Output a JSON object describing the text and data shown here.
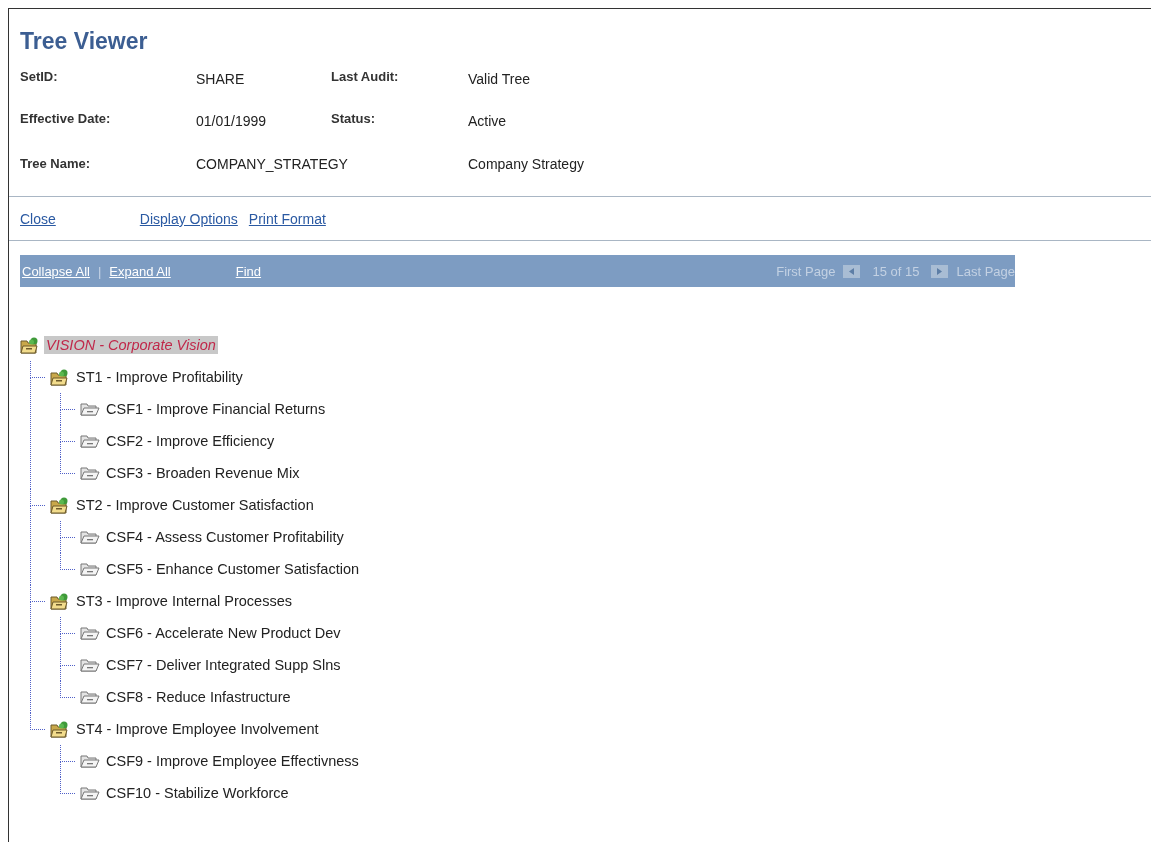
{
  "title": "Tree Viewer",
  "fields": [
    {
      "label": "SetID:",
      "value": "SHARE",
      "label2": "Last Audit:",
      "value2": "Valid Tree"
    },
    {
      "label": "Effective Date:",
      "value": "01/01/1999",
      "label2": "Status:",
      "value2": "Active"
    },
    {
      "label": "Tree Name:",
      "value": "COMPANY_STRATEGY",
      "value2": "Company Strategy"
    }
  ],
  "links": [
    "Close",
    "Display Options",
    "Print Format"
  ],
  "toolbar": {
    "links": [
      "Collapse All",
      "Expand All",
      "Find"
    ],
    "separator": "|",
    "first_page": "First Page",
    "range": "15 of 15",
    "last_page": "Last Page"
  },
  "tree": {
    "label": "VISION - Corporate Vision",
    "selected": true,
    "children": [
      {
        "label": "ST1 - Improve Profitability",
        "selected": false,
        "children": [
          {
            "label": "CSF1 - Improve Financial Returns",
            "selected": false
          },
          {
            "label": "CSF2 - Improve Efficiency",
            "selected": false
          },
          {
            "label": "CSF3 - Broaden Revenue Mix",
            "selected": false
          }
        ]
      },
      {
        "label": "ST2 - Improve Customer Satisfaction",
        "selected": false,
        "children": [
          {
            "label": "CSF4 - Assess Customer Profitability",
            "selected": false
          },
          {
            "label": "CSF5 - Enhance Customer Satisfaction",
            "selected": false
          }
        ]
      },
      {
        "label": "ST3 - Improve Internal Processes",
        "selected": false,
        "children": [
          {
            "label": "CSF6 - Accelerate New Product Dev",
            "selected": false
          },
          {
            "label": "CSF7 - Deliver Integrated Supp Slns",
            "selected": false
          },
          {
            "label": "CSF8 - Reduce Infastructure",
            "selected": false
          }
        ]
      },
      {
        "label": "ST4 - Improve Employee Involvement",
        "selected": false,
        "children": [
          {
            "label": "CSF9 - Improve Employee Effectivness",
            "selected": false
          },
          {
            "label": "CSF10 - Stabilize Workforce",
            "selected": false
          }
        ]
      }
    ]
  }
}
